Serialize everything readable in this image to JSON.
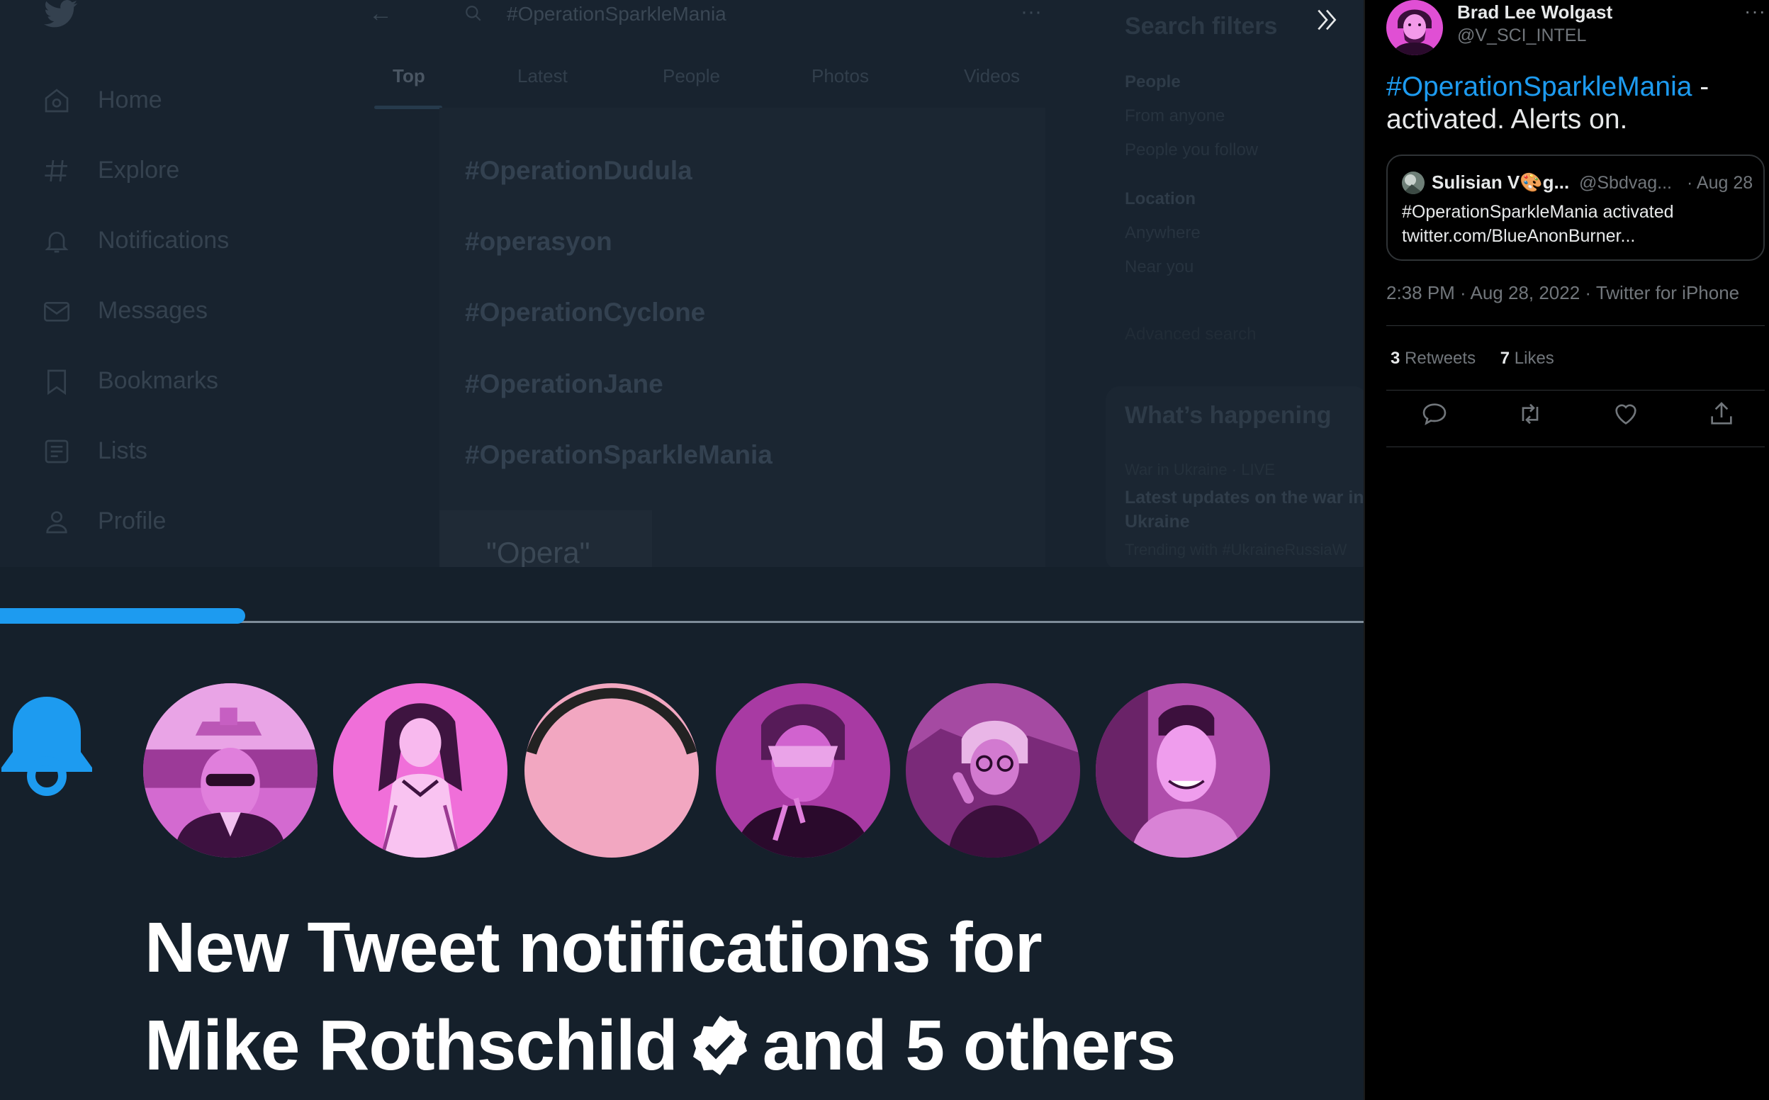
{
  "background_app": {
    "search_query": "#OperationSparkleMania",
    "nav": [
      {
        "label": "Home",
        "icon": "home-icon"
      },
      {
        "label": "Explore",
        "icon": "hashtag-icon"
      },
      {
        "label": "Notifications",
        "icon": "bell-icon"
      },
      {
        "label": "Messages",
        "icon": "mail-icon"
      },
      {
        "label": "Bookmarks",
        "icon": "bookmark-icon"
      },
      {
        "label": "Lists",
        "icon": "list-icon"
      },
      {
        "label": "Profile",
        "icon": "person-icon"
      }
    ],
    "tabs": [
      "Top",
      "Latest",
      "People",
      "Photos",
      "Videos"
    ],
    "suggestions": [
      "#OperationDudula",
      "#operasyon",
      "#OperationCyclone",
      "#OperationJane",
      "#OperationSparkleMania"
    ],
    "partial_query": "\"Opera\"",
    "search_filters": {
      "title": "Search filters",
      "people_heading": "People",
      "people_options": [
        "From anyone",
        "People you follow"
      ],
      "location_heading": "Location",
      "location_options": [
        "Anywhere",
        "Near you"
      ],
      "advanced": "Advanced search"
    },
    "whats_happening": {
      "title": "What’s happening",
      "category": "War in Ukraine · LIVE",
      "headline": "Latest updates on the war in Ukraine",
      "trending": "Trending with #UkraineRussiaW"
    }
  },
  "notification": {
    "progress": 0.18,
    "headline_line1": "New Tweet notifications for",
    "headline_name": "Mike Rothschild",
    "headline_rest": "and 5 others",
    "accent": "#1d9bf0"
  },
  "tweet": {
    "author_name": "Brad Lee Wolgast",
    "author_handle": "@V_SCI_INTEL",
    "more": "···",
    "hashtag": "#OperationSparkleMania",
    "text_rest": " - activated. Alerts on.",
    "quote": {
      "name": "Sulisian V🎨g...",
      "handle": "@Sbdvag...",
      "date": "· Aug 28",
      "line1": "#OperationSparkleMania activated",
      "line2": "twitter.com/BlueAnonBurner..."
    },
    "meta": "2:38 PM · Aug 28, 2022 · Twitter for iPhone",
    "retweets_count": "3",
    "retweets_label": "Retweets",
    "likes_count": "7",
    "likes_label": "Likes",
    "actions": [
      "reply-icon",
      "retweet-icon",
      "like-icon",
      "share-icon"
    ]
  }
}
